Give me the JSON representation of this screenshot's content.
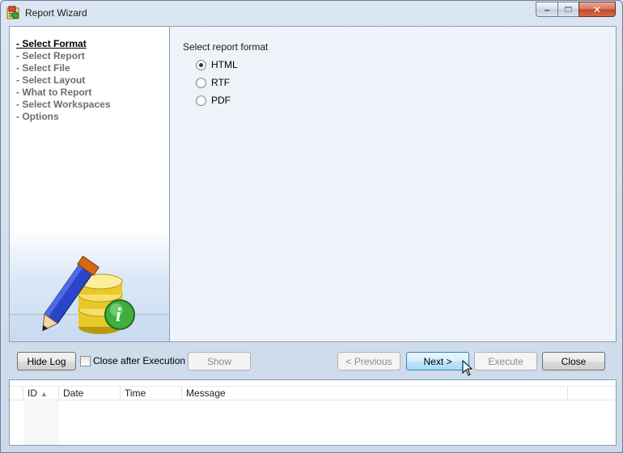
{
  "window": {
    "title": "Report Wizard",
    "icon": "report-wizard-app-icon"
  },
  "nav": {
    "items": [
      {
        "label": "- Select Format",
        "active": true
      },
      {
        "label": "- Select Report",
        "active": false
      },
      {
        "label": "- Select File",
        "active": false
      },
      {
        "label": "- Select Layout",
        "active": false
      },
      {
        "label": "- What to Report",
        "active": false
      },
      {
        "label": "- Select Workspaces",
        "active": false
      },
      {
        "label": "- Options",
        "active": false
      }
    ]
  },
  "content": {
    "format_label": "Select report format",
    "options": [
      {
        "label": "HTML",
        "selected": true
      },
      {
        "label": "RTF",
        "selected": false
      },
      {
        "label": "PDF",
        "selected": false
      }
    ]
  },
  "buttons": {
    "hide_log": "Hide Log",
    "close_after_execution": "Close after Execution",
    "close_after_execution_checked": false,
    "show": "Show",
    "previous": "< Previous",
    "next": "Next >",
    "execute": "Execute",
    "close": "Close"
  },
  "log": {
    "columns": [
      "ID",
      "Date",
      "Time",
      "Message"
    ],
    "sort_column": "ID",
    "sort_direction": "ascending",
    "rows": []
  },
  "colors": {
    "accent_hover": "#bee6fd",
    "window_frame": "#cbd9ea"
  }
}
